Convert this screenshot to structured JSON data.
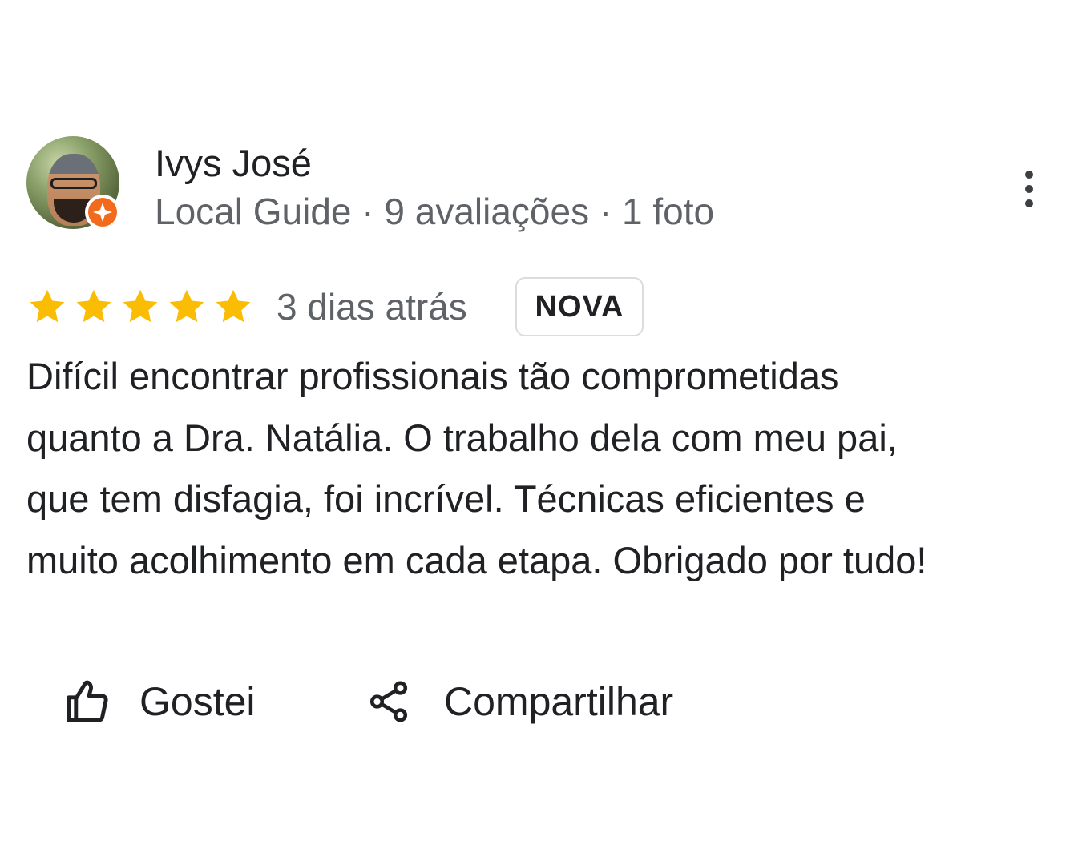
{
  "reviewer": {
    "name": "Ivys José",
    "meta": "Local Guide · 9 avaliações · 1 foto"
  },
  "review": {
    "rating": 5,
    "rating_max": 5,
    "date": "3 dias atrás",
    "badge": "NOVA",
    "text_lines": [
      "Difícil encontrar profissionais tão comprometidas",
      "quanto a Dra. Natália. O trabalho dela com meu pai,",
      "que tem disfagia, foi incrível. Técnicas eficientes e",
      "muito acolhimento em cada etapa. Obrigado por tudo!"
    ]
  },
  "actions": {
    "like_label": "Gostei",
    "share_label": "Compartilhar"
  },
  "icons": {
    "star": "star-icon",
    "more": "more-vert-icon",
    "like": "thumb-up-icon",
    "share": "share-icon",
    "guide_badge": "local-guide-badge-icon"
  },
  "colors": {
    "star": "#fbbc04",
    "text_primary": "#202124",
    "text_secondary": "#5f6368",
    "badge_border": "#dadce0",
    "guide_badge": "#f26b1d"
  }
}
